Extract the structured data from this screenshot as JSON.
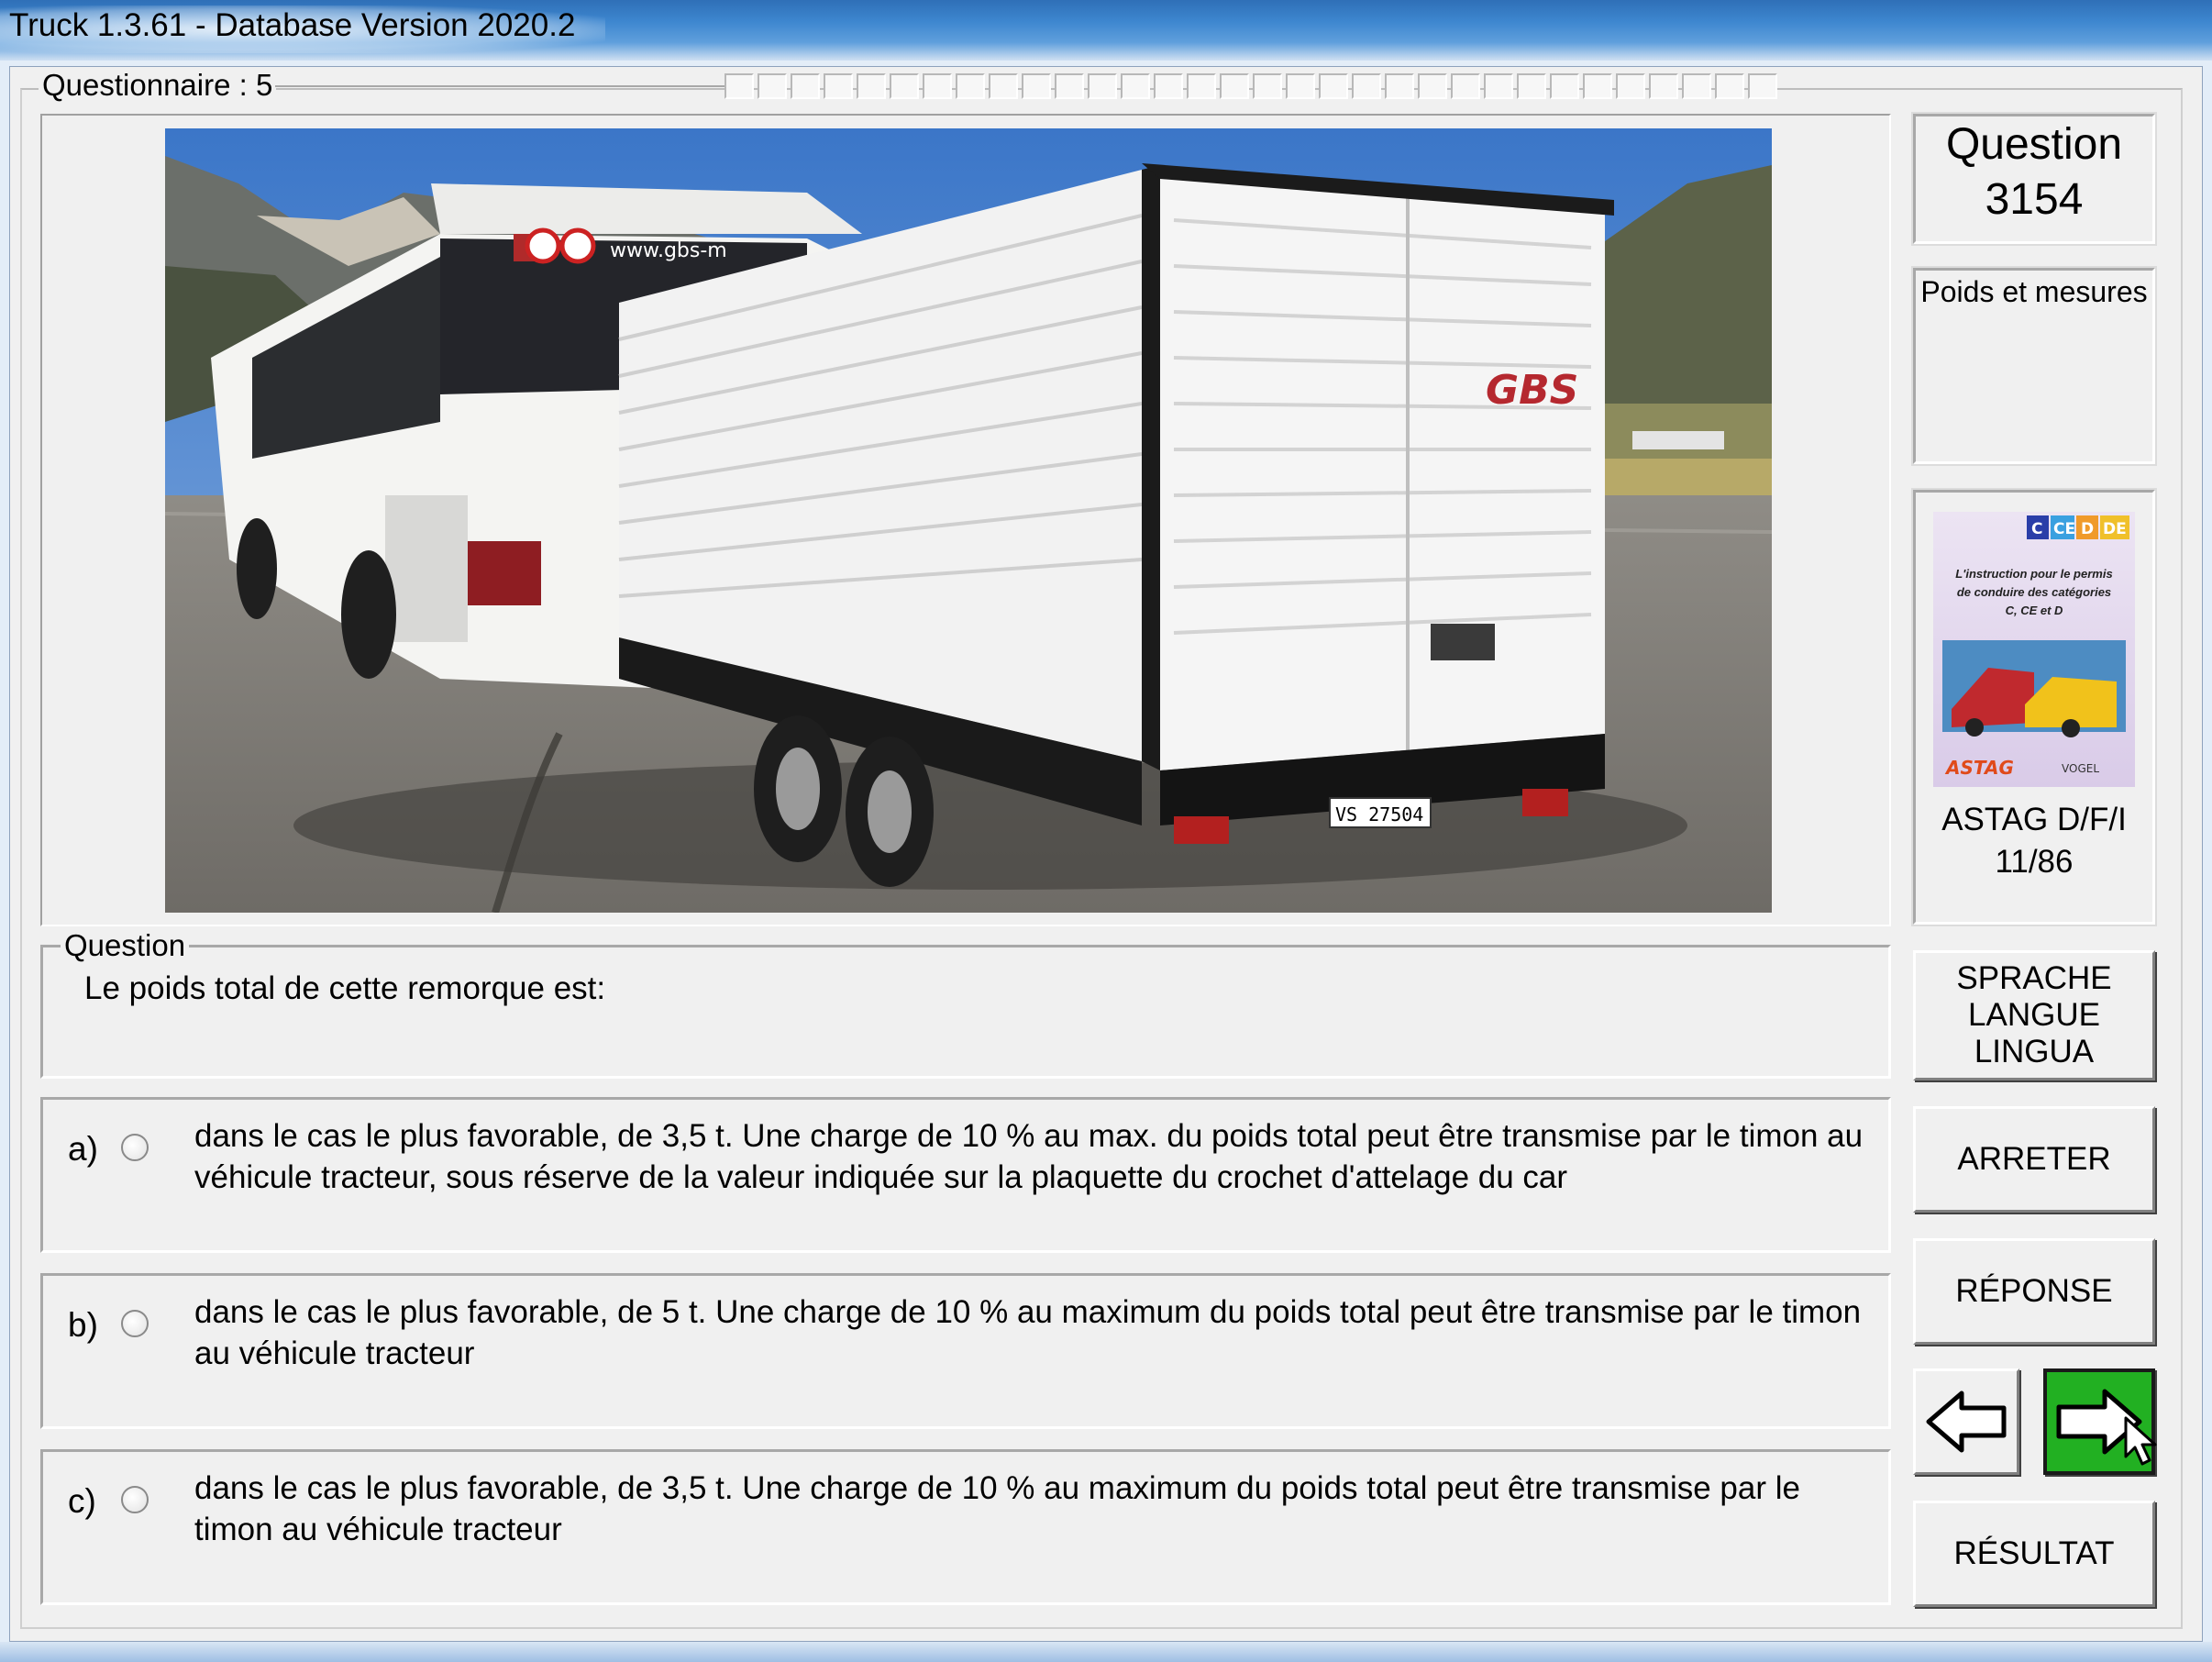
{
  "window": {
    "title": "Truck 1.3.61 - Database Version 2020.2"
  },
  "questionnaire": {
    "label": "Questionnaire : 5",
    "progress_cells": 32
  },
  "question_panel": {
    "heading": "Question",
    "number": "3154",
    "category": "Poids et mesures"
  },
  "book": {
    "badges": [
      "C",
      "CE",
      "D",
      "DE"
    ],
    "cover_text": "L'instruction pour le permis de conduire des catégories C, CE et D",
    "caption_line1": "ASTAG D/F/I",
    "caption_line2": "11/86"
  },
  "question": {
    "legend": "Question",
    "text": "Le poids total de cette remorque est:"
  },
  "answers": [
    {
      "letter": "a)",
      "text": "dans le cas le plus favorable, de 3,5 t. Une charge de 10 % au max. du poids total peut être transmise par le timon au véhicule tracteur, sous réserve de la valeur indiquée sur la plaquette du crochet d'attelage du car"
    },
    {
      "letter": "b)",
      "text": "dans le cas le plus favorable, de 5 t. Une charge de 10 % au maximum du poids total peut être transmise par le timon au véhicule tracteur"
    },
    {
      "letter": "c)",
      "text": "dans le cas le plus favorable, de 3,5 t. Une charge de 10 % au maximum du poids total peut être transmise par le timon au véhicule tracteur"
    }
  ],
  "buttons": {
    "language_line1": "SPRACHE",
    "language_line2": "LANGUE",
    "language_line3": "LINGUA",
    "stop": "ARRETER",
    "answer": "RÉPONSE",
    "result": "RÉSULTAT"
  },
  "photo": {
    "bus_text": "www.gbs-m",
    "brand": "GBS",
    "plate": "VS 27504"
  },
  "colors": {
    "next_button": "#22b022",
    "titlebar": "#3d86cf"
  }
}
